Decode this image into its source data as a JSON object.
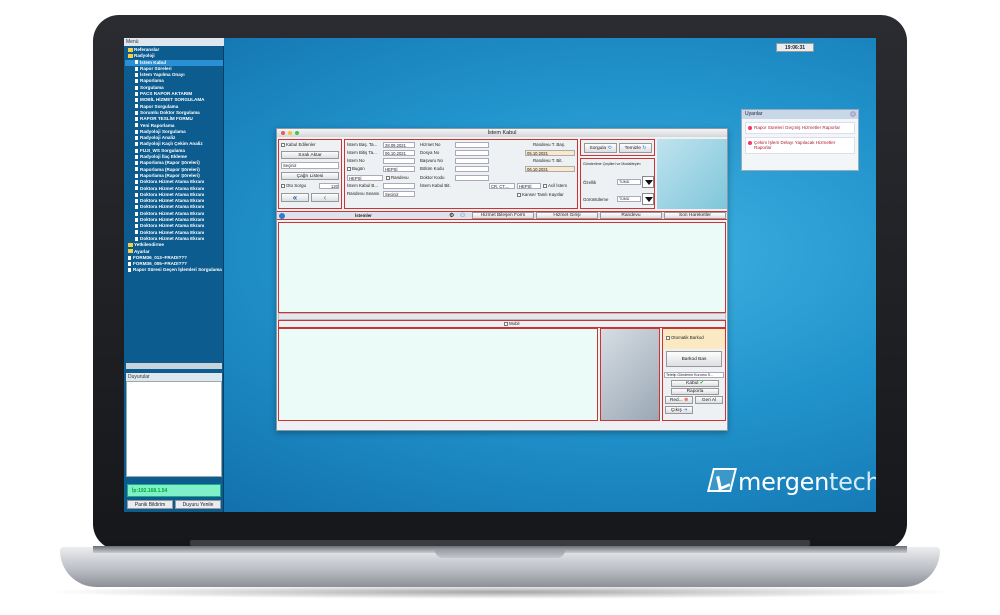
{
  "sidebar": {
    "title": "Menü",
    "tree": [
      {
        "label": "Referanslar",
        "type": "folder",
        "indent": 1
      },
      {
        "label": "Radyoloji",
        "type": "folder",
        "indent": 1
      },
      {
        "label": "İstem Kabul",
        "type": "doc",
        "indent": 2,
        "selected": true
      },
      {
        "label": "Rapor Süreleri",
        "type": "doc",
        "indent": 2
      },
      {
        "label": "İstem Yapılma Onayı",
        "type": "doc",
        "indent": 2
      },
      {
        "label": "Raporlama",
        "type": "doc",
        "indent": 2
      },
      {
        "label": "Sorgulama",
        "type": "doc",
        "indent": 2
      },
      {
        "label": "PACS RAPOR AKTARIM",
        "type": "doc",
        "indent": 2
      },
      {
        "label": "MOBİL HİZMET SORGULAMA",
        "type": "doc",
        "indent": 2
      },
      {
        "label": "Rapor Sorgulama",
        "type": "doc",
        "indent": 2
      },
      {
        "label": "Sorumlu Doktor Sorgulama",
        "type": "doc",
        "indent": 2
      },
      {
        "label": "RAPOR TESLİM FORMU",
        "type": "doc",
        "indent": 2
      },
      {
        "label": "Yeni Raporlama",
        "type": "doc",
        "indent": 2
      },
      {
        "label": "Radyoloji Sorgulama",
        "type": "doc",
        "indent": 2
      },
      {
        "label": "Radyoloji Analiz",
        "type": "doc",
        "indent": 2
      },
      {
        "label": "Radyoloji Kaçlı Çekim Analiz",
        "type": "doc",
        "indent": 2
      },
      {
        "label": "FUJI_WS Sorgulama",
        "type": "doc",
        "indent": 2
      },
      {
        "label": "Radyoloji İlaç Ekleme",
        "type": "doc",
        "indent": 2
      },
      {
        "label": "Raporlama (Rapor Şöreleri)",
        "type": "doc",
        "indent": 2
      },
      {
        "label": "Raporlama (Rapor Şöreleri)",
        "type": "doc",
        "indent": 2
      },
      {
        "label": "Raporlama (Rapor Şöreleri)",
        "type": "doc",
        "indent": 2
      },
      {
        "label": "Doktora Hizmet Atama Ekranı",
        "type": "doc",
        "indent": 2
      },
      {
        "label": "Doktora Hizmet Atama Ekranı",
        "type": "doc",
        "indent": 2
      },
      {
        "label": "Doktora Hizmet Atama Ekranı",
        "type": "doc",
        "indent": 2
      },
      {
        "label": "Doktora Hizmet Atama Ekranı",
        "type": "doc",
        "indent": 2
      },
      {
        "label": "Doktora Hizmet Atama Ekranı",
        "type": "doc",
        "indent": 2
      },
      {
        "label": "Doktora Hizmet Atama Ekranı",
        "type": "doc",
        "indent": 2
      },
      {
        "label": "Doktora Hizmet Atama Ekranı",
        "type": "doc",
        "indent": 2
      },
      {
        "label": "Doktora Hizmet Atama Ekranı",
        "type": "doc",
        "indent": 2
      },
      {
        "label": "Doktora Hizmet Atama Ekranı",
        "type": "doc",
        "indent": 2
      },
      {
        "label": "Doktora Hizmet Atama Ekranı",
        "type": "doc",
        "indent": 2
      },
      {
        "label": "Yetkilendirme",
        "type": "folder",
        "indent": 1
      },
      {
        "label": "Ayarlar",
        "type": "folder",
        "indent": 1
      },
      {
        "label": "FORM36_013~FRADI???",
        "type": "doc",
        "indent": 1
      },
      {
        "label": "FORM36_005~FRADI???",
        "type": "doc",
        "indent": 1
      },
      {
        "label": "Rapor Süresi Geçen İşlemleri Sorgulama",
        "type": "doc",
        "indent": 1
      }
    ],
    "box_title": "Duyurular",
    "ip_label": "İp:192.168.1.54",
    "panic_button": "Panik Bildirim",
    "refresh_button": "Duyuru Yenile"
  },
  "clock": "19:06:31",
  "notifications": {
    "title": "Uyarılar",
    "items": [
      "Rapor Süreleri Geçmiş Hizmetler Raporlar",
      "Çekim İşlem Delayı Yapılacak Hizmetler Raporlar"
    ]
  },
  "window": {
    "title": "İstem Kabul",
    "left": {
      "accepted_label": "Kabul Edilenler",
      "queue_button": "Sıralı Aktar",
      "select_value": "Seçiniz",
      "call_list_button": "Çağrı Listesi",
      "auto_query_label": "Oto Sorgu",
      "auto_query_value": "120",
      "nav_first": "«",
      "nav_prev": "‹"
    },
    "form": {
      "start_label": "İstem Baş. Ta...",
      "start_value": "28.09.2021",
      "end_label": "İstem Bitiş Ta...",
      "end_value": "06.10.2021",
      "istem_no_label": "İstem No",
      "today_label": "Bugün",
      "today_value": "HEPSİ",
      "type_value": "HEPSİ",
      "appointment_label": "Randevu",
      "kabul_birim_label": "İstem Kabul B...",
      "randevu_seansi_label": "Randevu Seansı",
      "randevu_seansi_value": "Seçiniz",
      "hizmet_no_label": "Hizmet No",
      "dosya_no_label": "Dosya No",
      "basvuru_no_label": "Başvuru No",
      "bolum_kodu_label": "Bölüm Kodu",
      "doktor_kodu_label": "Doktor Kodu",
      "kabul_bit_label": "İstem Kabul Bit.",
      "kabul_bit_value": "CR, CT,...",
      "kabul_bit_value2": "HEPSİ",
      "acil_label": "Acil İstem",
      "kanser_label": "Kanser Tanılı Kayıtlar",
      "randevu_bas_label": "Randevu T. Baş.",
      "randevu_bas_value": "05.10.2021",
      "randevu_bit_label": "Randevu T. Bit.",
      "randevu_bit_value": "06.10.2021"
    },
    "actions": {
      "query_button": "Sorgula",
      "clear_button": "Temizle",
      "subtitle": "Gönderilme Çeşitleri ve Modaliteyim",
      "ozellik_label": "Özellik",
      "ozellik_value": "TÜMÜ",
      "goruntuleme_label": "Görüntüleme",
      "goruntuleme_value": "TÜMÜ"
    },
    "tabs": {
      "istemler": "İstemler",
      "hizmet_bilesen": "Hizmet Bileşen Form",
      "hizmet_girisi": "Hizmet Girişi",
      "randevu": "Randevu",
      "son_hareketler": "Son Hareketler"
    },
    "mobil_label": "Mobil",
    "barcode": {
      "otomatik_label": "Otomatik Barkod",
      "bas_button": "Barkod Bas",
      "send_select": "Teletip Gönderim Kurumu S...",
      "kabul_button": "Kabul",
      "raporla_button": "Raporla",
      "red_button": "Red...",
      "geri_al_button": "Geri Al",
      "cikis_button": "Çıkış"
    }
  },
  "brand": {
    "part1": "mergen",
    "part2": "tech"
  },
  "colors": {
    "accent_red": "#cc3333",
    "desktop": "#2193cc",
    "sidebar": "#0c5c90"
  }
}
